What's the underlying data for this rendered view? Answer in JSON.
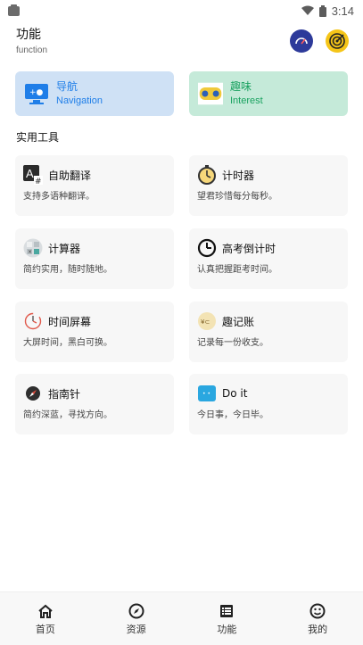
{
  "status_bar": {
    "time": "3:14"
  },
  "header": {
    "title": "功能",
    "subtitle": "function"
  },
  "quick_cards": [
    {
      "title": "导航",
      "subtitle": "Navigation",
      "icon": "monitor-icon"
    },
    {
      "title": "趣味",
      "subtitle": "Interest",
      "icon": "gamepad-icon"
    }
  ],
  "section": {
    "title": "实用工具"
  },
  "tools": [
    {
      "name": "自助翻译",
      "desc": "支持多语种翻译。",
      "icon": "translate-icon"
    },
    {
      "name": "计时器",
      "desc": "望君珍惜每分每秒。",
      "icon": "stopwatch-icon"
    },
    {
      "name": "计算器",
      "desc": "简约实用，随时随地。",
      "icon": "calculator-icon"
    },
    {
      "name": "高考倒计时",
      "desc": "认真把握距考时间。",
      "icon": "countdown-clock-icon"
    },
    {
      "name": "时间屏幕",
      "desc": "大屏时间，黑白可换。",
      "icon": "clock-screen-icon"
    },
    {
      "name": "趣记账",
      "desc": "记录每一份收支。",
      "icon": "ledger-icon"
    },
    {
      "name": "指南针",
      "desc": "简约深蓝，寻找方向。",
      "icon": "compass-icon"
    },
    {
      "name": "Do it",
      "desc": "今日事，今日毕。",
      "icon": "todo-icon"
    }
  ],
  "bottom_nav": [
    {
      "label": "首页",
      "icon": "home-icon"
    },
    {
      "label": "资源",
      "icon": "compass-nav-icon"
    },
    {
      "label": "功能",
      "icon": "list-icon"
    },
    {
      "label": "我的",
      "icon": "smile-icon"
    }
  ],
  "colors": {
    "nav_card": "#cfe1f5",
    "interest_card": "#c5ead9",
    "nav_text": "#1f7ee8",
    "interest_text": "#1aa260",
    "tool_bg": "#f7f7f7"
  }
}
